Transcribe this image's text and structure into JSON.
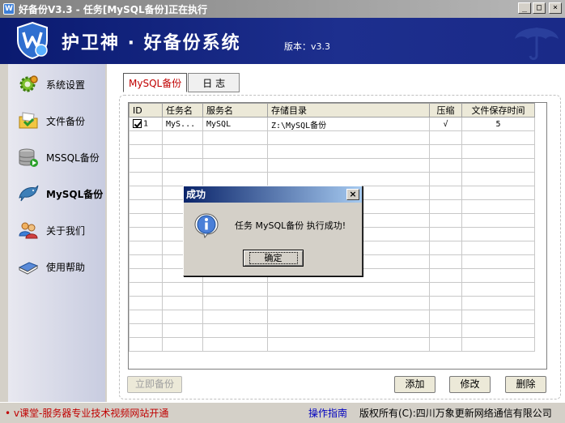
{
  "window": {
    "title": "好备份V3.3 - 任务[MySQL备份]正在执行",
    "app_icon_letter": "W",
    "minimize": "_",
    "maximize": "□",
    "close": "×"
  },
  "banner": {
    "app_name": "护卫神 · 好备份系统",
    "version": "版本：v3.3"
  },
  "sidebar": {
    "items": [
      {
        "label": "系统设置",
        "icon": "gear-icon"
      },
      {
        "label": "文件备份",
        "icon": "folder-icon"
      },
      {
        "label": "MSSQL备份",
        "icon": "database-icon"
      },
      {
        "label": "MySQL备份",
        "icon": "dolphin-icon",
        "active": true
      },
      {
        "label": "关于我们",
        "icon": "users-icon"
      },
      {
        "label": "使用帮助",
        "icon": "book-icon"
      }
    ]
  },
  "tabs": [
    {
      "label": "MySQL备份",
      "active": true
    },
    {
      "label": "日 志",
      "active": false
    }
  ],
  "table": {
    "columns": [
      "ID",
      "任务名",
      "服务名",
      "存储目录",
      "压缩",
      "文件保存时间"
    ],
    "rows": [
      {
        "checked": true,
        "id": "1",
        "task": "MyS...",
        "service": "MySQL",
        "dir": "Z:\\MySQL备份",
        "compress": "√",
        "keep": "5"
      }
    ]
  },
  "buttons": {
    "backup_now": "立即备份",
    "add": "添加",
    "edit": "修改",
    "delete": "删除"
  },
  "status": {
    "promo": "• v课堂-服务器专业技术视频网站开通",
    "guide": "操作指南",
    "copyright": "版权所有(C):四川万象更新网络通信有限公司"
  },
  "dialog": {
    "title": "成功",
    "close": "×",
    "message": "任务 MySQL备份 执行成功!",
    "ok": "确定"
  },
  "colors": {
    "banner": "#1d2f8e",
    "active_tab_text": "#c00000",
    "promo_text": "#c00000",
    "guide_text": "#0000c0",
    "dialog_title": "#0a246a"
  }
}
